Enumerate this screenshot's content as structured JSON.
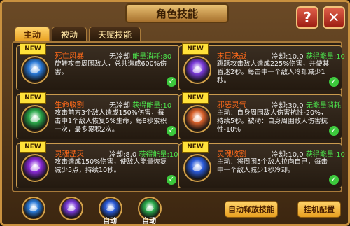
{
  "window": {
    "title": "角色技能"
  },
  "header": {
    "help_label": "?",
    "close_label": "✕"
  },
  "tabs": [
    {
      "label": "主动",
      "active": true
    },
    {
      "label": "被动",
      "active": false
    },
    {
      "label": "天赋技能",
      "active": false
    }
  ],
  "skills": [
    {
      "badge": "NEW",
      "name": "死亡风暴",
      "cooldown": "无冷却",
      "energy_label": "能量消耗:80",
      "desc": "旋转攻击周围敌人，总共造成600%伤害。",
      "icon": "storm-icon",
      "color": "#2a7ad8",
      "checked": true
    },
    {
      "badge": "NEW",
      "name": "末日决战",
      "cooldown": "冷却:10.0",
      "energy_label": "获得能量:10",
      "desc": "跳跃攻击敌人造成225%伤害，并使其昏迷2秒。每击中一个敌人冷却减少1秒。",
      "icon": "doom-icon",
      "color": "#7a3ad8",
      "checked": true
    },
    {
      "badge": "NEW",
      "name": "生命收割",
      "cooldown": "无冷却",
      "energy_label": "获得能量:10",
      "desc": "攻击前方3个敌人造成150%伤害，每击中1个敌人恢复5%生命，每8秒累积一次，最多累积2次。",
      "icon": "reap-icon",
      "color": "#2aa84a",
      "checked": true
    },
    {
      "badge": "NEW",
      "name": "邪恶灵气",
      "cooldown": "冷却:30.0",
      "energy_label": "无能量消耗",
      "desc": "主动：自身周围敌人伤害抗性-20%，持续5秒。被动：自身周围敌人伤害抗性-10%",
      "icon": "aura-icon",
      "color": "#d8602a",
      "checked": true
    },
    {
      "badge": "NEW",
      "name": "灵魂湮灭",
      "cooldown": "冷却:8.0",
      "energy_label": "获得能量:10",
      "desc": "攻击造成150%伤害，使敌人能量恢复减少5点，持续10秒。",
      "icon": "soul-icon",
      "color": "#8a2ad8",
      "checked": true
    },
    {
      "badge": "NEW",
      "name": "灵魂收割",
      "cooldown": "冷却:10.0",
      "energy_label": "获得能量:10",
      "desc": "主动：将周围5个敌人拉向自己，每击中一个敌人减少1秒冷却。",
      "icon": "harvest-icon",
      "color": "#2a5ad8",
      "checked": true
    }
  ],
  "bottom": {
    "slots": [
      {
        "icon": "storm-icon",
        "color": "#2a7ad8",
        "auto": ""
      },
      {
        "icon": "doom-icon",
        "color": "#7a3ad8",
        "auto": ""
      },
      {
        "icon": "harvest-icon",
        "color": "#2a5ad8",
        "auto": "自动"
      },
      {
        "icon": "reap-icon",
        "color": "#2aa84a",
        "auto": "自动"
      }
    ],
    "auto_release_label": "自动释放技能",
    "afk_label": "挂机配置"
  }
}
